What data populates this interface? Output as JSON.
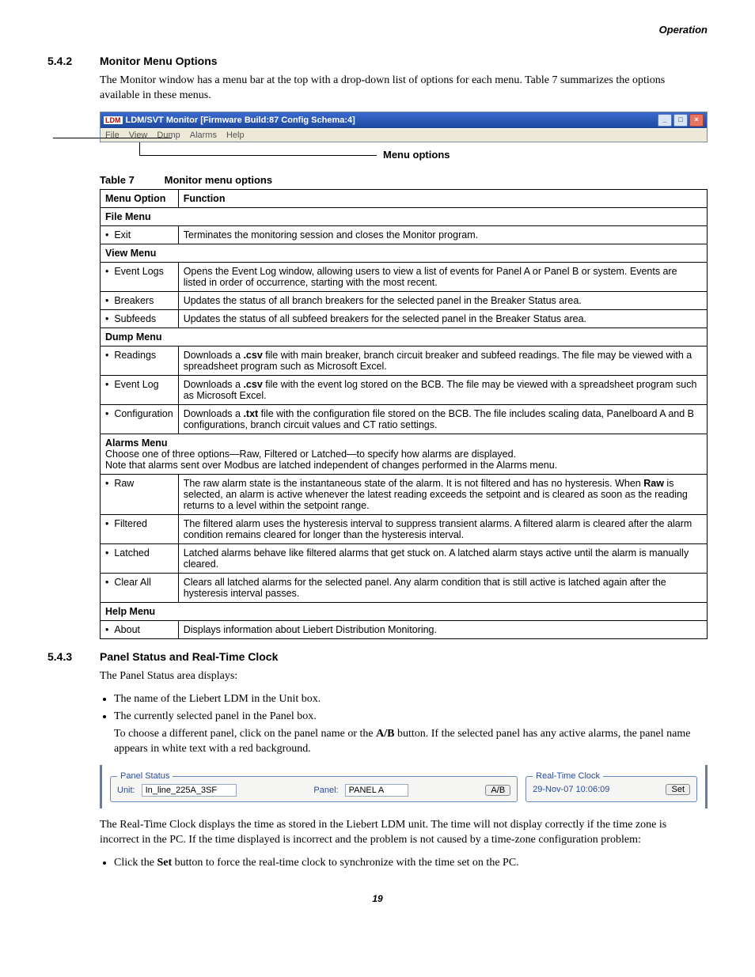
{
  "header_right": "Operation",
  "sec542": {
    "num": "5.4.2",
    "title": "Monitor Menu Options",
    "para": "The Monitor window has a menu bar at the top with a drop-down list of options for each menu. Table 7 summarizes the options available in these menus."
  },
  "win": {
    "title": "LDM/SVT Monitor [Firmware Build:87 Config Schema:4]",
    "menus": [
      "File",
      "View",
      "Dump",
      "Alarms",
      "Help"
    ]
  },
  "callout_label": "Menu options",
  "table": {
    "caption_num": "Table 7",
    "caption_title": "Monitor menu options",
    "head": [
      "Menu Option",
      "Function"
    ],
    "sections": [
      {
        "name": "File Menu",
        "rows": [
          {
            "opt": "Exit",
            "fn": "Terminates the monitoring session and closes the Monitor program."
          }
        ]
      },
      {
        "name": "View Menu",
        "rows": [
          {
            "opt": "Event Logs",
            "fn": "Opens the Event Log window, allowing users to view a list of events for Panel A or Panel B or system. Events are listed in order of occurrence, starting with the most recent."
          },
          {
            "opt": "Breakers",
            "fn": "Updates the status of all branch breakers for the selected panel in the Breaker Status area."
          },
          {
            "opt": "Subfeeds",
            "fn": "Updates the status of all subfeed breakers for the selected panel in the Breaker Status area."
          }
        ]
      },
      {
        "name": "Dump Menu",
        "rows": [
          {
            "opt": "Readings",
            "fn_html": "Downloads a <b>.csv</b> file with main breaker, branch circuit breaker and subfeed readings. The file may be viewed with a spreadsheet program such as Microsoft Excel."
          },
          {
            "opt": "Event Log",
            "fn_html": "Downloads a <b>.csv</b> file with the event log stored on the BCB. The file may be viewed with a spreadsheet program such as Microsoft Excel."
          },
          {
            "opt": "Configuration",
            "fn_html": "Downloads a <b>.txt</b> file with the configuration file stored on the BCB. The file includes scaling data, Panelboard A and B configurations, branch circuit values and CT ratio settings."
          }
        ]
      },
      {
        "name_html": "<b>Alarms Menu</b><br>Choose one of three options—Raw, Filtered or Latched—to specify how alarms are displayed.<br>Note that alarms sent over Modbus are latched independent of changes performed in the Alarms menu.",
        "rows": [
          {
            "opt": "Raw",
            "fn_html": "The raw alarm state is the instantaneous state of the alarm. It is not filtered and has no hysteresis. When <b>Raw</b> is selected, an alarm is active whenever the latest reading exceeds the setpoint and is cleared as soon as the reading returns to a level within the setpoint range."
          },
          {
            "opt": "Filtered",
            "fn": "The filtered alarm uses the hysteresis interval to suppress transient alarms. A filtered alarm is cleared after the alarm condition remains cleared for longer than the hysteresis interval."
          },
          {
            "opt": "Latched",
            "fn": "Latched alarms behave like filtered alarms that get stuck on. A latched alarm stays active until the alarm is manually cleared."
          },
          {
            "opt": "Clear All",
            "fn": "Clears all latched alarms for the selected panel. Any alarm condition that is still active is latched again after the hysteresis interval passes."
          }
        ]
      },
      {
        "name": "Help Menu",
        "rows": [
          {
            "opt": "About",
            "fn": "Displays information about Liebert Distribution Monitoring."
          }
        ]
      }
    ]
  },
  "sec543": {
    "num": "5.4.3",
    "title": "Panel Status and Real-Time Clock",
    "intro": "The Panel Status area displays:",
    "bullets": [
      "The name of the Liebert LDM in the Unit box.",
      "The currently selected panel in the Panel box."
    ],
    "sub_html": "To choose a different panel, click on the panel name or the <b>A/B</b> button. If the selected panel has any active alarms, the panel name appears in white text with a red background.",
    "after_html": "The Real-Time Clock displays the time as stored in the Liebert LDM unit. The time will not display correctly if the time zone is incorrect in the PC. If the time displayed is incorrect and the problem is not caused by a time-zone configuration problem:",
    "after_bullet_html": "Click the <b>Set</b> button to force the real-time clock to synchronize with the time set on the PC."
  },
  "panel_status": {
    "legend": "Panel Status",
    "unit_label": "Unit:",
    "unit_value": "In_line_225A_3SF",
    "panel_label": "Panel:",
    "panel_value": "PANEL A",
    "ab_button": "A/B"
  },
  "rtc": {
    "legend": "Real-Time Clock",
    "value": "29-Nov-07 10:06:09",
    "set_button": "Set"
  },
  "page_number": "19"
}
